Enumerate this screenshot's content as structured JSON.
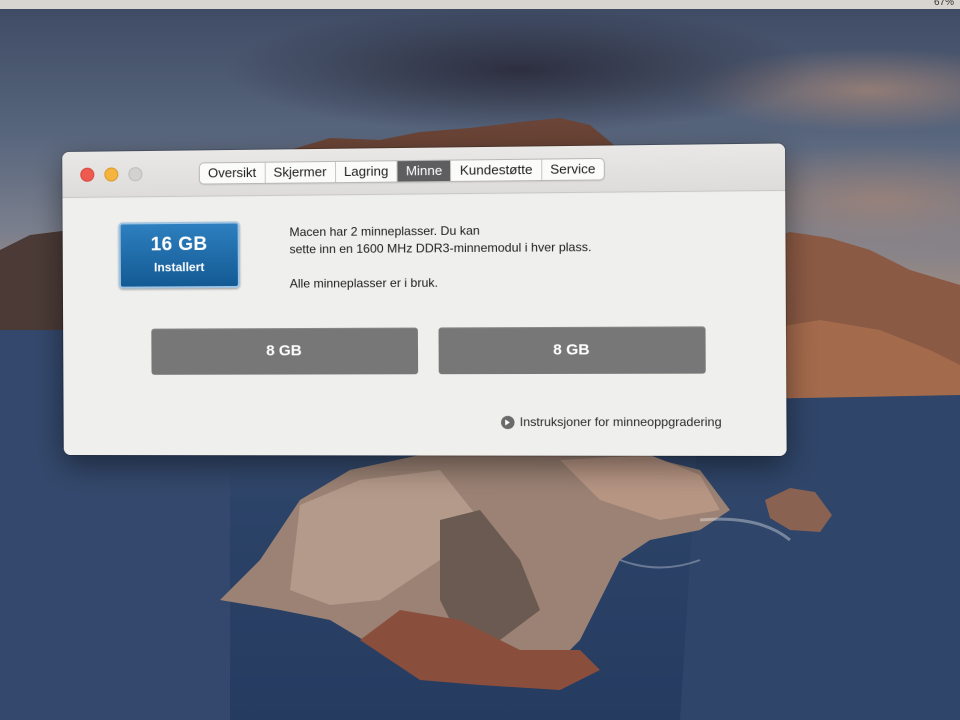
{
  "menubar": {
    "battery_text": "67%"
  },
  "window": {
    "tabs": [
      {
        "label": "Oversikt",
        "active": false
      },
      {
        "label": "Skjermer",
        "active": false
      },
      {
        "label": "Lagring",
        "active": false
      },
      {
        "label": "Minne",
        "active": true
      },
      {
        "label": "Kundestøtte",
        "active": false
      },
      {
        "label": "Service",
        "active": false
      }
    ],
    "memory": {
      "installed_size": "16 GB",
      "installed_label": "Installert",
      "description_line1": "Macen har 2 minneplasser. Du kan",
      "description_line2": "sette inn en 1600 MHz DDR3-minnemodul i hver plass.",
      "status_text": "Alle minneplasser er i bruk.",
      "slots": [
        {
          "size": "8 GB"
        },
        {
          "size": "8 GB"
        }
      ],
      "upgrade_link": "Instruksjoner for minneoppgradering"
    }
  },
  "colors": {
    "badge": "#1e6fae",
    "active_tab": "#5e5e60",
    "slot": "#777777",
    "close": "#ee5a50",
    "minimize": "#f4b43e",
    "zoom_disabled": "#d3d2d0"
  },
  "icons": {
    "upgrade_link": "arrow-circle-right-icon"
  }
}
